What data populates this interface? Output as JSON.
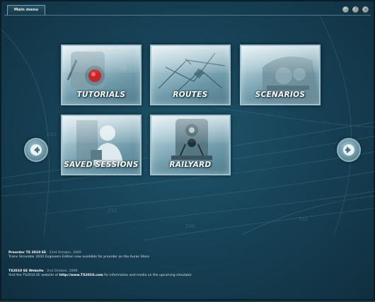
{
  "window": {
    "tab_label": "Main menu",
    "buttons": [
      "minimize",
      "help",
      "close"
    ]
  },
  "tiles": [
    {
      "label": "TUTORIALS",
      "icon": "tutorial-button-icon"
    },
    {
      "label": "ROUTES",
      "icon": "route-map-icon"
    },
    {
      "label": "SCENARIOS",
      "icon": "locomotive-icon"
    },
    {
      "label": "SAVED SESSIONS",
      "icon": "driver-icon"
    },
    {
      "label": "RAILYARD",
      "icon": "train-front-icon"
    }
  ],
  "nav": {
    "prev_icon": "arrow-left-icon",
    "next_icon": "arrow-right-icon"
  },
  "news": [
    {
      "title": "Preorder TS 2010 EE",
      "date": " - 23rd October, 2009",
      "body": "Trains Simulator 2010 Engineers Edition now available for preorder on the Auran Store"
    },
    {
      "title": "TS2010 EE Website",
      "date": " - 2nd October, 2009",
      "body_pre": "Visit the TS2010 EE website at ",
      "link": "http://www.TS2010.com",
      "body_post": " for information and media on the upcoming simulator"
    }
  ],
  "colors": {
    "background": "#174257",
    "tile_border": "#9cc2cf",
    "label": "#ffffff"
  }
}
